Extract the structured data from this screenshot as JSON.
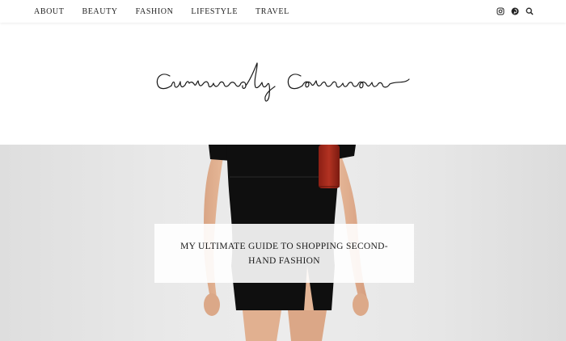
{
  "nav": {
    "items": [
      {
        "label": "ABOUT"
      },
      {
        "label": "BEAUTY"
      },
      {
        "label": "FASHION"
      },
      {
        "label": "LIFESTYLE"
      },
      {
        "label": "TRAVEL"
      }
    ],
    "social_icons": [
      "instagram-icon",
      "pinterest-icon",
      "search-icon"
    ]
  },
  "header": {
    "logo_text": "Curiously Conscious"
  },
  "hero": {
    "post_title": "MY ULTIMATE GUIDE TO SHOPPING SECOND-HAND FASHION"
  },
  "colors": {
    "background": "#ffffff",
    "hero_background": "#e8e8e8",
    "dress": "#0f0f0f",
    "bag": "#a8281a",
    "text": "#1a1a1a"
  }
}
